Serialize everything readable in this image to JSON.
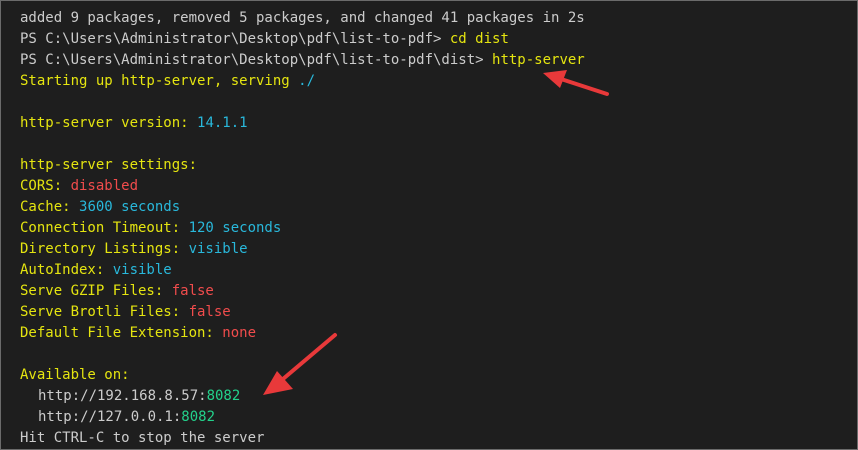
{
  "terminal": {
    "line_summary": "added 9 packages, removed 5 packages, and changed 41 packages in 2s",
    "prompt1": "PS C:\\Users\\Administrator\\Desktop\\pdf\\list-to-pdf> ",
    "cmd1": "cd dist",
    "prompt2": "PS C:\\Users\\Administrator\\Desktop\\pdf\\list-to-pdf\\dist> ",
    "cmd2": "http-server",
    "starting": "Starting up http-server, serving ",
    "serve_path": "./",
    "version_label": "http-server version: ",
    "version_value": "14.1.1",
    "settings_label": "http-server settings:",
    "settings": [
      {
        "label": "CORS: ",
        "value": "disabled",
        "color": "red"
      },
      {
        "label": "Cache: ",
        "value": "3600 seconds",
        "color": "cyan"
      },
      {
        "label": "Connection Timeout: ",
        "value": "120 seconds",
        "color": "cyan"
      },
      {
        "label": "Directory Listings: ",
        "value": "visible",
        "color": "cyan"
      },
      {
        "label": "AutoIndex: ",
        "value": "visible",
        "color": "cyan"
      },
      {
        "label": "Serve GZIP Files: ",
        "value": "false",
        "color": "red"
      },
      {
        "label": "Serve Brotli Files: ",
        "value": "false",
        "color": "red"
      },
      {
        "label": "Default File Extension: ",
        "value": "none",
        "color": "red"
      }
    ],
    "available_label": "Available on:",
    "addresses": [
      {
        "host": "http://192.168.8.57:",
        "port": "8082"
      },
      {
        "host": "http://127.0.0.1:",
        "port": "8082"
      }
    ],
    "hint": "Hit CTRL-C to stop the server"
  },
  "colors": {
    "background": "#1e1e1e",
    "default_text": "#cccccc",
    "yellow": "#e5e510",
    "cyan": "#29b8db",
    "red": "#f14c4c",
    "green": "#23d18b",
    "annotation_arrow": "#e8393a"
  }
}
